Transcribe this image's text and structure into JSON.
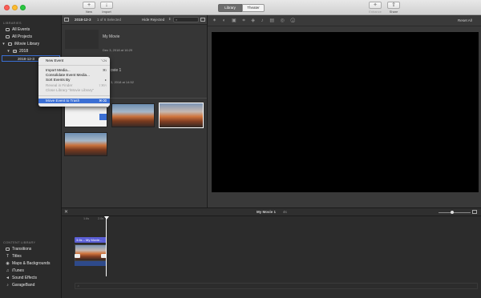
{
  "toolbar": {
    "new_label": "New",
    "import_label": "Import",
    "library_tab": "Library",
    "theater_tab": "Theater",
    "enhance_label": "Enhance",
    "share_label": "Share"
  },
  "sidebar": {
    "libraries_header": "LIBRARIES",
    "items": [
      {
        "label": "All Events"
      },
      {
        "label": "All Projects"
      },
      {
        "label": "iMovie Library"
      },
      {
        "label": "2018"
      },
      {
        "label": "2018-12-3"
      }
    ],
    "content_header": "CONTENT LIBRARY",
    "content_items": [
      {
        "label": "Transitions"
      },
      {
        "label": "Titles"
      },
      {
        "label": "Maps & Backgrounds"
      },
      {
        "label": "iTunes"
      },
      {
        "label": "Sound Effects"
      },
      {
        "label": "GarageBand"
      }
    ]
  },
  "browser": {
    "event_name": "2018-12-3",
    "selection": "1 of 6 Selected",
    "filter": "Hide Rejected",
    "project_title": "My Movie",
    "project_date": "Dec 3, 2018 at 16:29",
    "project2_title": "ovie 1",
    "project2_date": "3, 2018 at 14:52"
  },
  "context_menu": {
    "items": [
      {
        "label": "New Event",
        "shortcut": "⌥N",
        "disabled": false
      },
      {
        "label": "Import Media...",
        "shortcut": "⌘I",
        "disabled": false
      },
      {
        "label": "Consolidate Event Media...",
        "shortcut": "",
        "disabled": false
      },
      {
        "label": "Sort Events By",
        "shortcut": "▸",
        "disabled": false
      },
      {
        "label": "Reveal in Finder",
        "shortcut": "⇧⌘R",
        "disabled": true
      },
      {
        "label": "Close Library \"iMovie Library\"",
        "shortcut": "",
        "disabled": true
      },
      {
        "label": "Move Event to Trash",
        "shortcut": "⌘⌫",
        "disabled": false,
        "selected": true
      }
    ]
  },
  "right_toolbar": {
    "reset_all": "Reset All"
  },
  "timeline": {
    "project_name": "My Movie 1",
    "duration": "4s",
    "ticks": [
      "1.6s",
      "2.0s"
    ],
    "clip_label": "3.6s – My Movie..."
  },
  "colors": {
    "selection": "#3b6fd4",
    "clip_title": "#5b5fd6",
    "playhead": "#ffffff"
  }
}
